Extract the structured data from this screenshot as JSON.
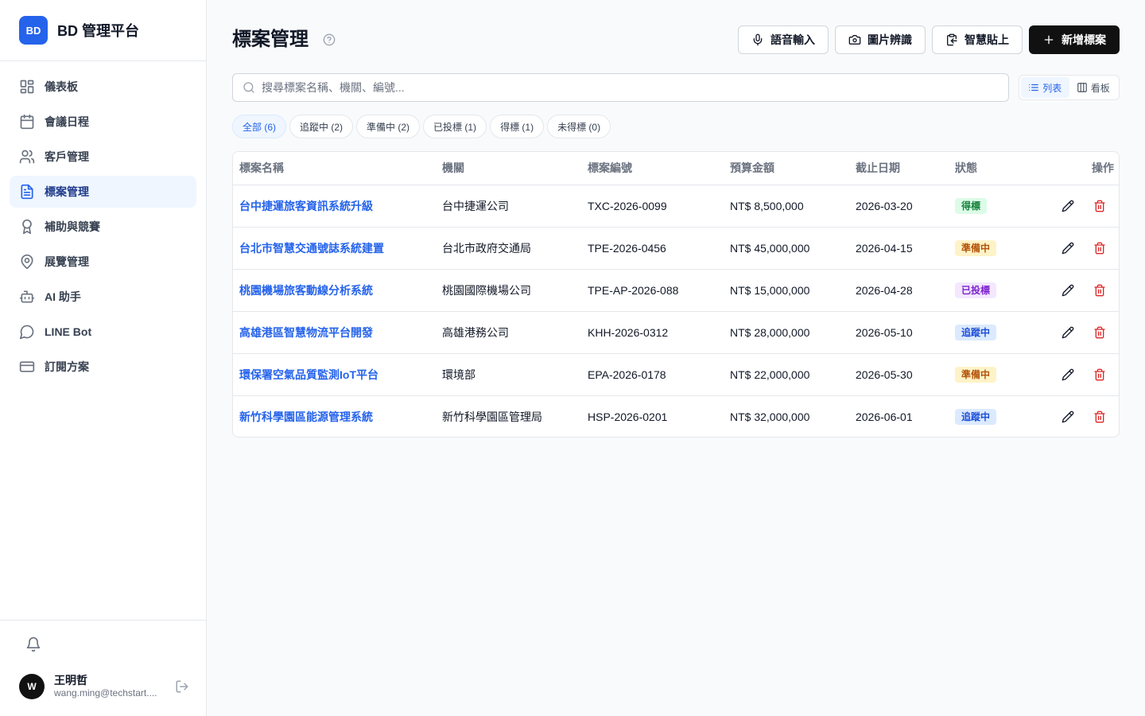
{
  "brand": {
    "logo": "BD",
    "name": "BD 管理平台",
    "accent": "#2563eb"
  },
  "sidebar": {
    "items": [
      {
        "label": "儀表板",
        "icon": "dashboard-icon",
        "active": false
      },
      {
        "label": "會議日程",
        "icon": "calendar-icon",
        "active": false
      },
      {
        "label": "客戶管理",
        "icon": "users-icon",
        "active": false
      },
      {
        "label": "標案管理",
        "icon": "file-text-icon",
        "active": true
      },
      {
        "label": "補助與競賽",
        "icon": "award-icon",
        "active": false
      },
      {
        "label": "展覽管理",
        "icon": "map-pin-icon",
        "active": false
      },
      {
        "label": "AI 助手",
        "icon": "bot-icon",
        "active": false
      },
      {
        "label": "LINE Bot",
        "icon": "message-circle-icon",
        "active": false
      },
      {
        "label": "訂閱方案",
        "icon": "credit-card-icon",
        "active": false
      }
    ]
  },
  "user": {
    "initial": "W",
    "name": "王明哲",
    "email": "wang.ming@techstart...."
  },
  "header": {
    "title": "標案管理",
    "voice_label": "語音輸入",
    "image_label": "圖片辨識",
    "paste_label": "智慧貼上",
    "new_label": "新增標案"
  },
  "search": {
    "placeholder": "搜尋標案名稱、機關、編號..."
  },
  "view": {
    "list_label": "列表",
    "board_label": "看板"
  },
  "filters": [
    {
      "label": "全部 (6)",
      "active": true
    },
    {
      "label": "追蹤中 (2)",
      "active": false
    },
    {
      "label": "準備中 (2)",
      "active": false
    },
    {
      "label": "已投標 (1)",
      "active": false
    },
    {
      "label": "得標 (1)",
      "active": false
    },
    {
      "label": "未得標 (0)",
      "active": false
    }
  ],
  "table": {
    "columns": [
      "標案名稱",
      "機關",
      "標案編號",
      "預算金額",
      "截止日期",
      "狀態",
      "操作"
    ],
    "rows": [
      {
        "name": "台中捷運旅客資訊系統升級",
        "agency": "台中捷運公司",
        "code": "TXC-2026-0099",
        "budget": "NT$ 8,500,000",
        "deadline": "2026-03-20",
        "status": "得標"
      },
      {
        "name": "台北市智慧交通號誌系統建置",
        "agency": "台北市政府交通局",
        "code": "TPE-2026-0456",
        "budget": "NT$ 45,000,000",
        "deadline": "2026-04-15",
        "status": "準備中"
      },
      {
        "name": "桃園機場旅客動線分析系統",
        "agency": "桃園國際機場公司",
        "code": "TPE-AP-2026-088",
        "budget": "NT$ 15,000,000",
        "deadline": "2026-04-28",
        "status": "已投標"
      },
      {
        "name": "高雄港區智慧物流平台開發",
        "agency": "高雄港務公司",
        "code": "KHH-2026-0312",
        "budget": "NT$ 28,000,000",
        "deadline": "2026-05-10",
        "status": "追蹤中"
      },
      {
        "name": "環保署空氣品質監測IoT平台",
        "agency": "環境部",
        "code": "EPA-2026-0178",
        "budget": "NT$ 22,000,000",
        "deadline": "2026-05-30",
        "status": "準備中"
      },
      {
        "name": "新竹科學園區能源管理系統",
        "agency": "新竹科學園區管理局",
        "code": "HSP-2026-0201",
        "budget": "NT$ 32,000,000",
        "deadline": "2026-06-01",
        "status": "追蹤中"
      }
    ]
  },
  "status_colors": {
    "得標": {
      "bg": "#dcfce7",
      "fg": "#15803d"
    },
    "準備中": {
      "bg": "#fef3c7",
      "fg": "#b45309"
    },
    "已投標": {
      "bg": "#f3e8ff",
      "fg": "#7e22ce"
    },
    "追蹤中": {
      "bg": "#dbeafe",
      "fg": "#1d4ed8"
    }
  }
}
